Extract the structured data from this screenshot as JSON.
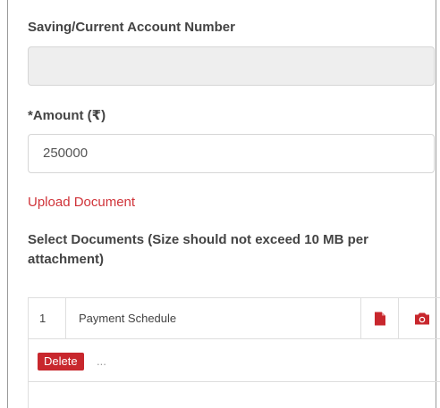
{
  "form": {
    "account_label": "Saving/Current Account Number",
    "account_value": "",
    "amount_label": "*Amount (₹)",
    "amount_value": "250000",
    "upload_link": "Upload Document",
    "select_documents_label": "Select Documents (Size should not exceed 10 MB per attachment)"
  },
  "documents": {
    "rows": [
      {
        "index": "1",
        "name": "Payment Schedule"
      }
    ],
    "delete_label": "Delete",
    "ellipsis": "...",
    "icons": [
      "file-icon",
      "camera-icon"
    ],
    "accent_color": "#c8272d"
  }
}
